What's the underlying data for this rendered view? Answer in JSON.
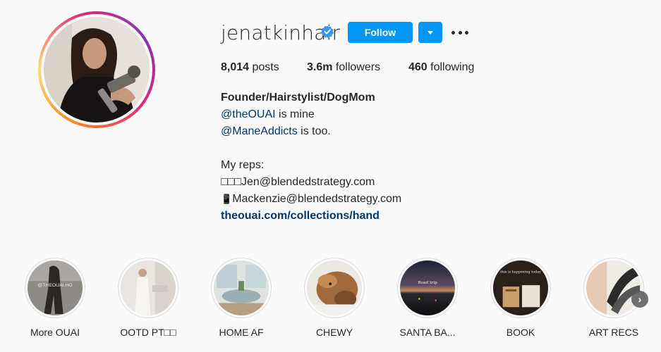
{
  "profile": {
    "username": "jenatkinhair",
    "verified_icon": "verified-badge-icon",
    "follow_label": "Follow",
    "stats": {
      "posts_count": "8,014",
      "posts_label": "posts",
      "followers_count": "3.6m",
      "followers_label": "followers",
      "following_count": "460",
      "following_label": "following"
    },
    "bio": {
      "name": "Founder/Hairstylist/DogMom",
      "line1_mention": "@theOUAI",
      "line1_rest": " is mine",
      "line2_mention": "@ManeAddicts",
      "line2_rest": " is too.",
      "reps_heading": "My reps:",
      "rep1_prefix": "□□□",
      "rep1": "Jen@blendedstrategy.com",
      "rep2_prefix": "📱",
      "rep2": "Mackenzie@blendedstrategy.com",
      "link": "theouai.com/collections/hand"
    }
  },
  "highlights": [
    {
      "label": "More OUAI"
    },
    {
      "label": "OOTD PT□□"
    },
    {
      "label": "HOME AF"
    },
    {
      "label": "CHEWY"
    },
    {
      "label": "SANTA BA..."
    },
    {
      "label": "BOOK"
    },
    {
      "label": "ART RECS"
    }
  ],
  "highlight_overlays": {
    "more_ouai_text": "@THEOUAI.HO",
    "book_text": "this is happening today",
    "santa_text": "Road trip"
  },
  "colors": {
    "accent": "#0095f6",
    "link": "#00376b",
    "text": "#262626",
    "background": "#fafafa"
  }
}
